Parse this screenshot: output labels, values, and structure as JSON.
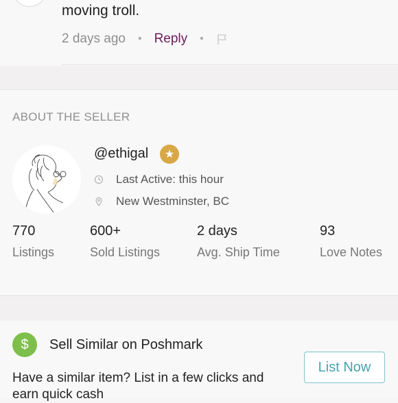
{
  "comment": {
    "text": "moving troll.",
    "time": "2 days ago",
    "reply_label": "Reply"
  },
  "seller": {
    "section_title": "ABOUT THE SELLER",
    "handle": "@ethigal",
    "last_active": "Last Active: this hour",
    "location": "New Westminster, BC",
    "stats": [
      {
        "value": "770",
        "label": "Listings"
      },
      {
        "value": "600+",
        "label": "Sold Listings"
      },
      {
        "value": "2 days",
        "label": "Avg. Ship Time"
      },
      {
        "value": "93",
        "label": "Love Notes"
      }
    ]
  },
  "sell_similar": {
    "title": "Sell Similar on Poshmark",
    "body": "Have a similar item? List in a few clicks and earn quick cash",
    "button_label": "List Now"
  },
  "colors": {
    "reply": "#6b1a5b",
    "badge": "#d8a847",
    "dollar": "#7dbf4a",
    "button_border": "#7ec3c8"
  }
}
